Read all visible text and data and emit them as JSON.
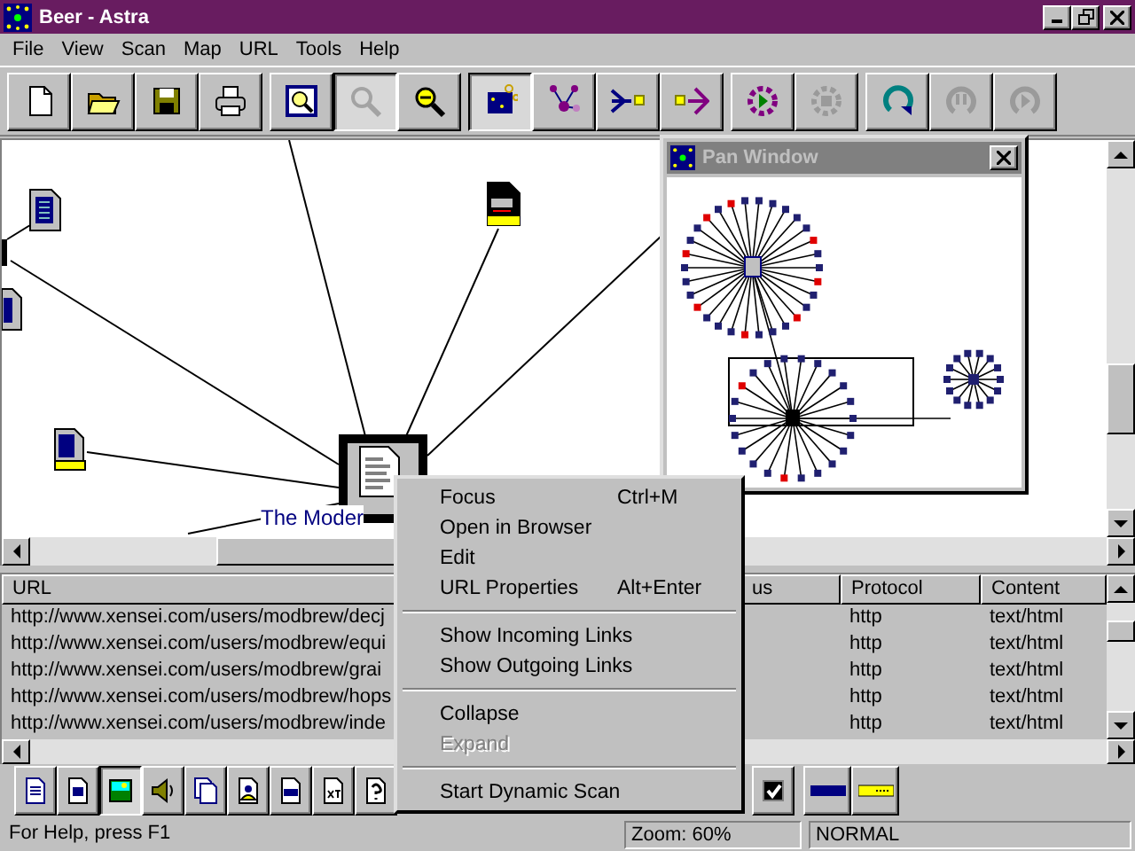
{
  "window": {
    "title": "Beer - Astra"
  },
  "menu": [
    "File",
    "View",
    "Scan",
    "Map",
    "URL",
    "Tools",
    "Help"
  ],
  "toolbar": [
    {
      "kind": "new",
      "selected": false,
      "disabled": false
    },
    {
      "kind": "open",
      "selected": false,
      "disabled": false
    },
    {
      "kind": "save",
      "selected": false,
      "disabled": false
    },
    {
      "kind": "print",
      "selected": false,
      "disabled": false
    },
    {
      "kind": "zoom-window",
      "selected": false,
      "disabled": false
    },
    {
      "kind": "zoom-in",
      "selected": true,
      "disabled": true
    },
    {
      "kind": "zoom-out",
      "selected": false,
      "disabled": false
    },
    {
      "kind": "map",
      "selected": true,
      "disabled": false
    },
    {
      "kind": "tree",
      "selected": false,
      "disabled": false
    },
    {
      "kind": "incoming",
      "selected": false,
      "disabled": false
    },
    {
      "kind": "outgoing",
      "selected": false,
      "disabled": false
    },
    {
      "kind": "scan",
      "selected": false,
      "disabled": false
    },
    {
      "kind": "scan-stop",
      "selected": false,
      "disabled": true
    },
    {
      "kind": "refresh",
      "selected": false,
      "disabled": false
    },
    {
      "kind": "pause",
      "selected": false,
      "disabled": true
    },
    {
      "kind": "resume",
      "selected": false,
      "disabled": true
    }
  ],
  "map": {
    "node_label": "The Moder"
  },
  "pan_window": {
    "title": "Pan Window"
  },
  "table": {
    "columns": [
      "URL",
      "us",
      "Protocol",
      "Content"
    ],
    "rows": [
      {
        "url": "http://www.xensei.com/users/modbrew/decj",
        "protocol": "http",
        "content": "text/html"
      },
      {
        "url": "http://www.xensei.com/users/modbrew/equi",
        "protocol": "http",
        "content": "text/html"
      },
      {
        "url": "http://www.xensei.com/users/modbrew/grai",
        "protocol": "http",
        "content": "text/html"
      },
      {
        "url": "http://www.xensei.com/users/modbrew/hops",
        "protocol": "http",
        "content": "text/html"
      },
      {
        "url": "http://www.xensei.com/users/modbrew/inde",
        "protocol": "http",
        "content": "text/html"
      }
    ]
  },
  "bottom_toolbar": {
    "buttons": [
      {
        "kind": "page",
        "selected": false
      },
      {
        "kind": "text-page",
        "selected": false
      },
      {
        "kind": "picture",
        "selected": true
      },
      {
        "kind": "speaker",
        "selected": false
      },
      {
        "kind": "pages",
        "selected": false
      },
      {
        "kind": "person",
        "selected": false
      },
      {
        "kind": "form",
        "selected": false
      },
      {
        "kind": "text-file",
        "selected": false
      },
      {
        "kind": "help",
        "selected": false
      }
    ],
    "filter_checkbox": {
      "checked": true
    },
    "legend_buttons": [
      {
        "kind": "blue-line"
      },
      {
        "kind": "yellow-line"
      }
    ]
  },
  "status_bar": [
    "For Help, press F1",
    "Zoom: 60%",
    "NORMAL"
  ],
  "context_menu": [
    {
      "kind": "item",
      "label": "Focus",
      "shortcut": "Ctrl+M",
      "disabled": false
    },
    {
      "kind": "item",
      "label": "Open in Browser",
      "disabled": false
    },
    {
      "kind": "item",
      "label": "Edit",
      "disabled": false
    },
    {
      "kind": "item",
      "label": "URL Properties",
      "shortcut": "Alt+Enter",
      "disabled": false
    },
    {
      "kind": "separator"
    },
    {
      "kind": "item",
      "label": "Show Incoming Links",
      "disabled": false
    },
    {
      "kind": "item",
      "label": "Show Outgoing Links",
      "disabled": false
    },
    {
      "kind": "separator"
    },
    {
      "kind": "item",
      "label": "Collapse",
      "disabled": false
    },
    {
      "kind": "item",
      "label": "Expand",
      "disabled": true
    },
    {
      "kind": "separator"
    },
    {
      "kind": "item",
      "label": "Start Dynamic Scan",
      "disabled": false
    }
  ]
}
